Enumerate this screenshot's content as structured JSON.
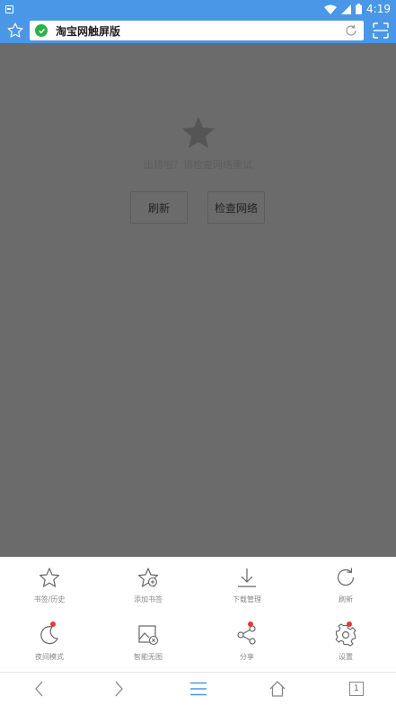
{
  "status_bar": {
    "time": "4:19"
  },
  "address_bar": {
    "title": "淘宝网触屏版"
  },
  "error_page": {
    "message": "出错啦？请检查网络重试",
    "refresh_label": "刷新",
    "check_network_label": "检查网络"
  },
  "menu": {
    "items": [
      {
        "label": "书签/历史",
        "icon": "star-icon",
        "badge": false
      },
      {
        "label": "添加书签",
        "icon": "star-add-icon",
        "badge": false
      },
      {
        "label": "下载管理",
        "icon": "download-icon",
        "badge": false
      },
      {
        "label": "刷新",
        "icon": "refresh-icon",
        "badge": false
      },
      {
        "label": "夜间模式",
        "icon": "moon-icon",
        "badge": true
      },
      {
        "label": "智能无图",
        "icon": "image-off-icon",
        "badge": false
      },
      {
        "label": "分享",
        "icon": "share-icon",
        "badge": true
      },
      {
        "label": "设置",
        "icon": "gear-icon",
        "badge": true
      }
    ]
  },
  "nav": {
    "tab_count": "1"
  },
  "colors": {
    "accent": "#4a97e8",
    "badge": "#e53935",
    "shield": "#2db04a"
  }
}
